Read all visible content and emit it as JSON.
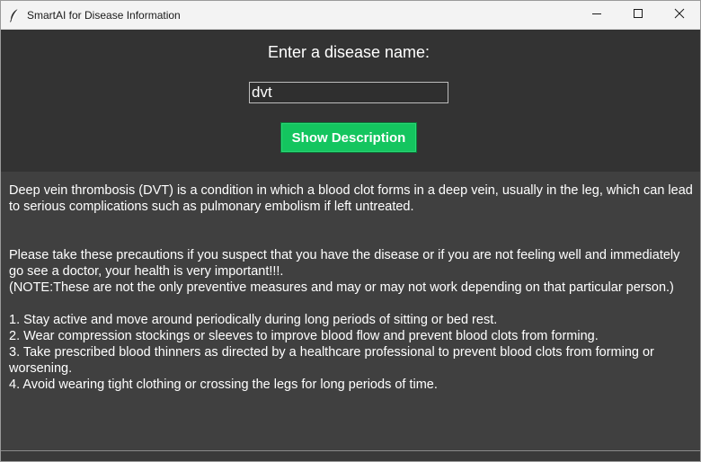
{
  "window": {
    "title": "SmartAI for Disease Information",
    "icons": {
      "app": "feather-icon",
      "minimize": "minimize-icon",
      "maximize": "maximize-icon",
      "close": "close-icon"
    }
  },
  "form": {
    "prompt_label": "Enter a disease name:",
    "disease_value": "dvt",
    "button_label": "Show Description"
  },
  "description": {
    "text": "Deep vein thrombosis (DVT) is a condition in which a blood clot forms in a deep vein, usually in the leg, which can lead to serious complications such as pulmonary embolism if left untreated.\n\n\nPlease take these precautions if you suspect that you have the disease or if you are not feeling well and immediately go see a doctor, your health is very important!!!.\n(NOTE:These are not the only preventive measures and may or may not work depending on that particular person.)\n\n1. Stay active and move around periodically during long periods of sitting or bed rest.\n2. Wear compression stockings or sleeves to improve blood flow and prevent blood clots from forming.\n3. Take prescribed blood thinners as directed by a healthcare professional to prevent blood clots from forming or worsening.\n4. Avoid wearing tight clothing or crossing the legs for long periods of time."
  },
  "colors": {
    "top_panel": "#333333",
    "description_panel": "#404040",
    "button": "#14c55f",
    "text": "#ffffff"
  }
}
